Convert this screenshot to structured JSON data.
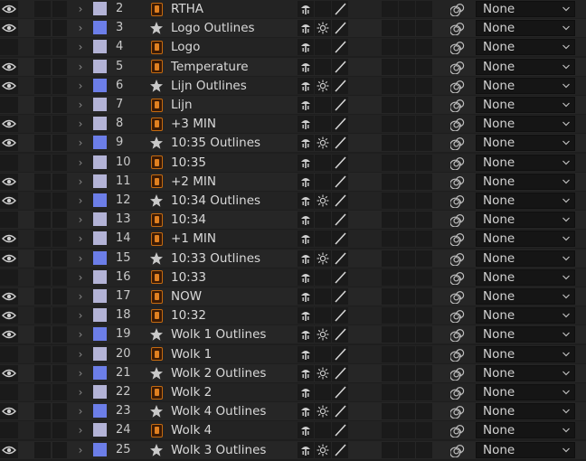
{
  "colors": {
    "precomp_label": "#b0b0d0",
    "shape_label": "#6c7ee8",
    "precomp_icon": "#c46a10"
  },
  "layers": [
    {
      "num": "2",
      "name": "RTHA",
      "type": "precomp",
      "visible": true,
      "label": "#b3b3d6",
      "parent": "None"
    },
    {
      "num": "3",
      "name": "Logo Outlines",
      "type": "shape",
      "visible": true,
      "label": "#6c7ee8",
      "parent": "None"
    },
    {
      "num": "4",
      "name": "Logo",
      "type": "precomp",
      "visible": false,
      "label": "#b3b3d6",
      "parent": "None"
    },
    {
      "num": "5",
      "name": "Temperature",
      "type": "precomp",
      "visible": true,
      "label": "#b3b3d6",
      "parent": "None"
    },
    {
      "num": "6",
      "name": "Lijn Outlines",
      "type": "shape",
      "visible": true,
      "label": "#6c7ee8",
      "parent": "None"
    },
    {
      "num": "7",
      "name": "Lijn",
      "type": "precomp",
      "visible": false,
      "label": "#b3b3d6",
      "parent": "None"
    },
    {
      "num": "8",
      "name": "+3 MIN",
      "type": "precomp",
      "visible": true,
      "label": "#b3b3d6",
      "parent": "None"
    },
    {
      "num": "9",
      "name": "10:35 Outlines",
      "type": "shape",
      "visible": true,
      "label": "#6c7ee8",
      "parent": "None"
    },
    {
      "num": "10",
      "name": "10:35",
      "type": "precomp",
      "visible": false,
      "label": "#b3b3d6",
      "parent": "None"
    },
    {
      "num": "11",
      "name": "+2 MIN",
      "type": "precomp",
      "visible": true,
      "label": "#b3b3d6",
      "parent": "None"
    },
    {
      "num": "12",
      "name": "10:34 Outlines",
      "type": "shape",
      "visible": true,
      "label": "#6c7ee8",
      "parent": "None"
    },
    {
      "num": "13",
      "name": "10:34",
      "type": "precomp",
      "visible": false,
      "label": "#b3b3d6",
      "parent": "None"
    },
    {
      "num": "14",
      "name": "+1 MIN",
      "type": "precomp",
      "visible": true,
      "label": "#b3b3d6",
      "parent": "None"
    },
    {
      "num": "15",
      "name": "10:33 Outlines",
      "type": "shape",
      "visible": true,
      "label": "#6c7ee8",
      "parent": "None"
    },
    {
      "num": "16",
      "name": "10:33",
      "type": "precomp",
      "visible": false,
      "label": "#b3b3d6",
      "parent": "None"
    },
    {
      "num": "17",
      "name": "NOW",
      "type": "precomp",
      "visible": true,
      "label": "#b3b3d6",
      "parent": "None"
    },
    {
      "num": "18",
      "name": "10:32",
      "type": "precomp",
      "visible": true,
      "label": "#b3b3d6",
      "parent": "None"
    },
    {
      "num": "19",
      "name": "Wolk 1 Outlines",
      "type": "shape",
      "visible": true,
      "label": "#6c7ee8",
      "parent": "None"
    },
    {
      "num": "20",
      "name": "Wolk 1",
      "type": "precomp",
      "visible": false,
      "label": "#b3b3d6",
      "parent": "None"
    },
    {
      "num": "21",
      "name": "Wolk 2 Outlines",
      "type": "shape",
      "visible": true,
      "label": "#6c7ee8",
      "parent": "None"
    },
    {
      "num": "22",
      "name": "Wolk 2",
      "type": "precomp",
      "visible": false,
      "label": "#b3b3d6",
      "parent": "None"
    },
    {
      "num": "23",
      "name": "Wolk 4 Outlines",
      "type": "shape",
      "visible": true,
      "label": "#6c7ee8",
      "parent": "None"
    },
    {
      "num": "24",
      "name": "Wolk 4",
      "type": "precomp",
      "visible": false,
      "label": "#b3b3d6",
      "parent": "None"
    },
    {
      "num": "25",
      "name": "Wolk 3 Outlines",
      "type": "shape",
      "visible": true,
      "label": "#6c7ee8",
      "parent": "None"
    }
  ],
  "icons": {
    "visibility": "eye-icon",
    "expand": "chevron-right-icon",
    "precomp": "precomp-layer-icon",
    "shape": "star-icon",
    "shy": "shy-icon",
    "collapse": "continuous-rasterize-icon",
    "quality": "quality-slash-icon",
    "pickwhip": "pickwhip-spiral-icon",
    "dropdown": "chevron-down-icon"
  }
}
